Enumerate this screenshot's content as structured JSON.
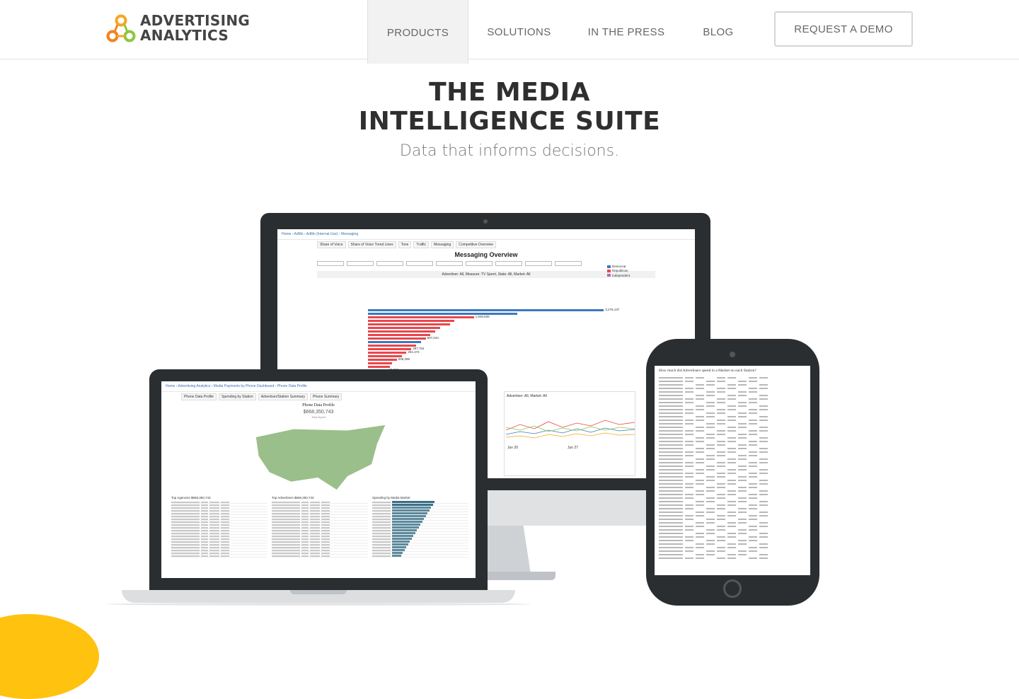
{
  "brand": {
    "name_line1": "ADVERTISING",
    "name_line2": "ANALYTICS",
    "logo_colors": [
      "#f6a623",
      "#f0831e",
      "#8dc63f"
    ]
  },
  "nav": {
    "items": [
      {
        "label": "PRODUCTS",
        "active": true
      },
      {
        "label": "SOLUTIONS",
        "active": false
      },
      {
        "label": "IN THE PRESS",
        "active": false
      },
      {
        "label": "BLOG",
        "active": false
      }
    ],
    "cta_label": "REQUEST A DEMO"
  },
  "hero": {
    "title_line1": "THE MEDIA",
    "title_line2": "INTELLIGENCE SUITE",
    "subtitle": "Data that informs decisions."
  },
  "monitor_dashboard": {
    "crumbs": "Home › AdMo › AdMo (Internal Use) › Messaging",
    "tabs": [
      "Share of Voice",
      "Share of Voice Trend Lines",
      "Tone",
      "Traffic",
      "Messaging",
      "Competitive Overview"
    ],
    "title": "Messaging Overview",
    "subhead": "Advertiser: All, Measure: TV Spent, State: All, Market: All",
    "legend": [
      {
        "label": "Democrat",
        "color": "#3a78c2"
      },
      {
        "label": "Republican",
        "color": "#e8474c"
      },
      {
        "label": "Independent",
        "color": "#b068c6"
      }
    ],
    "bar_series": [
      [
        0.98,
        "#3a78c2"
      ],
      [
        0.62,
        "#3a78c2"
      ],
      [
        0.44,
        "#e8474c"
      ],
      [
        0.36,
        "#e8474c"
      ],
      [
        0.34,
        "#e8474c"
      ],
      [
        0.3,
        "#e8474c"
      ],
      [
        0.28,
        "#e8474c"
      ],
      [
        0.26,
        "#e8474c"
      ],
      [
        0.24,
        "#e8474c"
      ],
      [
        0.22,
        "#3a78c2"
      ],
      [
        0.2,
        "#e8474c"
      ],
      [
        0.18,
        "#e8474c"
      ],
      [
        0.16,
        "#e8474c"
      ],
      [
        0.14,
        "#e8474c"
      ],
      [
        0.12,
        "#e8474c"
      ],
      [
        0.1,
        "#e8474c"
      ],
      [
        0.09,
        "#e8474c"
      ],
      [
        0.08,
        "#e8474c"
      ],
      [
        0.07,
        "#e8474c"
      ],
      [
        0.06,
        "#e8474c"
      ]
    ],
    "value_labels": [
      "3,276,137",
      "1,849,836",
      "607,044",
      "287,764",
      "251,374",
      "206,289",
      "43,958",
      "12,551"
    ],
    "overlay_title": "Advertiser: All, Market: All",
    "date_labels": [
      "Jun 20",
      "Jun 27"
    ]
  },
  "laptop_dashboard": {
    "crumbs": "Home › Advertising Analytics › Media Payments by Phone Dashboard › Phone Data Profile",
    "tabs": [
      "Phone Data Profile",
      "Spending by Station",
      "Advertiser/Station Summary",
      "Phone Summary"
    ],
    "title": "Phone Data Profile",
    "total": "$668,350,743",
    "total_caption": "Total Spent",
    "table_titles": [
      "Top Agencies $668,350,743",
      "Top Advertisers $668,350,743",
      "Spending by Media Market"
    ]
  },
  "phone_dashboard": {
    "title": "How much did Advertisers spend in a Market on each Station?"
  }
}
